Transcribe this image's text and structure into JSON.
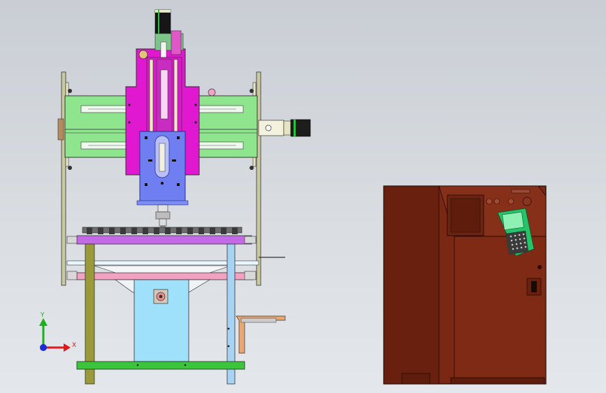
{
  "view": {
    "kind": "CAD assembly drawing (front view)",
    "background": "#d3d7dc"
  },
  "triad": {
    "y_label": "Y",
    "x_label": "X",
    "colors": {
      "x": "#e0191b",
      "y": "#19b21b",
      "z": "#1b2fd8"
    }
  },
  "palette": {
    "gantry_beam": "#8ee58e",
    "carriage": "#e019d0",
    "spindle_plate": "#6f7ef0",
    "table_top": "#c46ae6",
    "table_lower": "#f2a2c0",
    "column_left": "#9a9a3a",
    "column_right": "#a7d3f5",
    "pedestal": "#9fe0fb",
    "base_bar": "#3cc43c",
    "cabinet": "#7a2714",
    "cabinet_edge": "#4a1208",
    "pendant": "#25c46a"
  }
}
